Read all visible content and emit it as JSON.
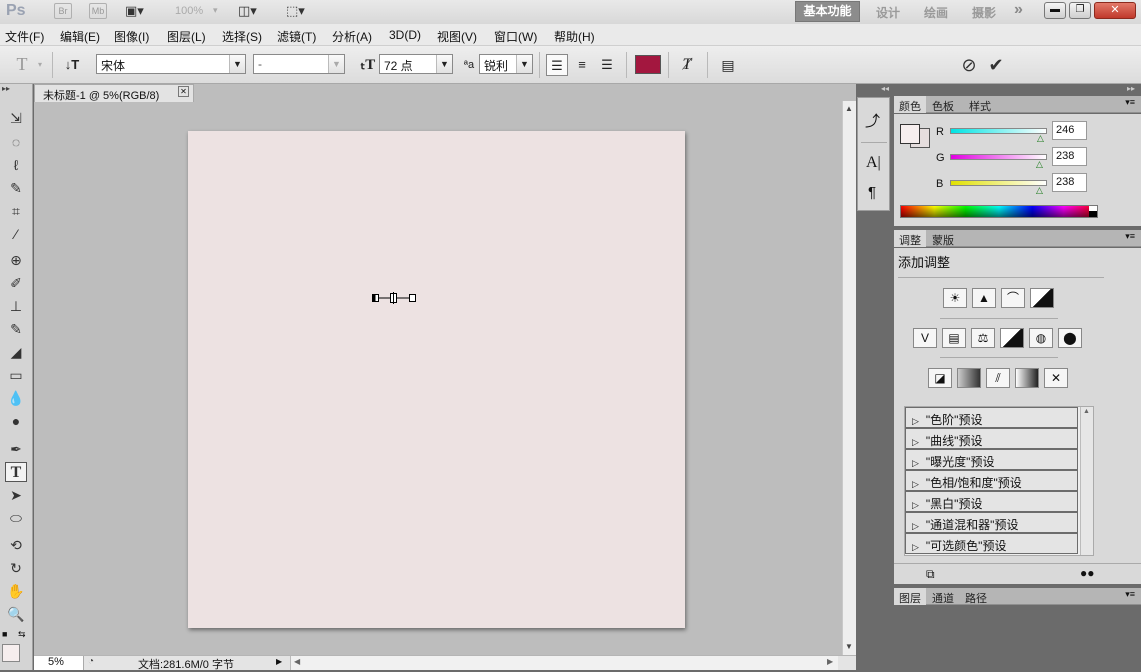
{
  "appbar": {
    "logo": "Ps",
    "bridge_label": "Br",
    "mini_bridge_label": "Mb",
    "zoom_value": "100%",
    "workspaces": [
      "基本功能",
      "设计",
      "绘画",
      "摄影"
    ],
    "more_label": "»"
  },
  "menu": [
    "文件(F)",
    "编辑(E)",
    "图像(I)",
    "图层(L)",
    "选择(S)",
    "滤镜(T)",
    "分析(A)",
    "3D(D)",
    "视图(V)",
    "窗口(W)",
    "帮助(H)"
  ],
  "options": {
    "font_family": "宋体",
    "font_style": "-",
    "font_size": "72 点",
    "aa_label": "ªa",
    "anti_alias": "锐利",
    "text_color": "#a3173f"
  },
  "document": {
    "tab_title": "未标题-1 @ 5%(RGB/8)",
    "canvas_color": "#ede2e2",
    "zoom": "5%",
    "doc_info": "文档:281.6M/0 字节"
  },
  "color_panel": {
    "tabs": [
      "颜色",
      "色板",
      "样式"
    ],
    "channels": [
      {
        "label": "R",
        "value": "246"
      },
      {
        "label": "G",
        "value": "238"
      },
      {
        "label": "B",
        "value": "238"
      }
    ]
  },
  "adjust_panel": {
    "tabs": [
      "调整",
      "蒙版"
    ],
    "heading": "添加调整",
    "presets": [
      "\"色阶\"预设",
      "\"曲线\"预设",
      "\"曝光度\"预设",
      "\"色相/饱和度\"预设",
      "\"黑白\"预设",
      "\"通道混和器\"预设",
      "\"可选颜色\"预设"
    ]
  },
  "layers_panel": {
    "tabs": [
      "图层",
      "通道",
      "路径"
    ]
  }
}
